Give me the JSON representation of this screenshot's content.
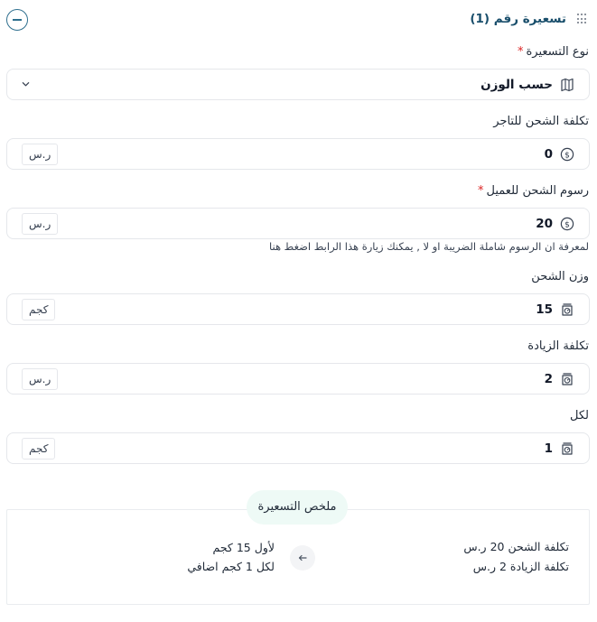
{
  "header": {
    "title": "تسعيرة رقم (1)"
  },
  "pricing_type": {
    "label": "نوع التسعيرة",
    "required_mark": "*",
    "value": "حسب الوزن"
  },
  "merchant_cost": {
    "label": "تكلفة الشحن للتاجر",
    "value": "0",
    "unit": "ر.س"
  },
  "customer_fee": {
    "label": "رسوم الشحن للعميل",
    "required_mark": "*",
    "value": "20",
    "unit": "ر.س",
    "hint": "لمعرفة ان الرسوم شاملة الضريبة او لا , يمكنك زيارة هذا الرابط اضغط هنا"
  },
  "weight": {
    "label": "وزن الشحن",
    "value": "15",
    "unit": "كجم"
  },
  "extra_cost": {
    "label": "تكلفة الزيادة",
    "value": "2",
    "unit": "ر.س"
  },
  "per": {
    "label": "لكل",
    "value": "1",
    "unit": "كجم"
  },
  "summary": {
    "title": "ملخص التسعيرة",
    "right_line1": "تكلفة الشحن 20 ر.س",
    "right_line2": "تكلفة الزيادة 2 ر.س",
    "left_line1": "لأول 15 كجم",
    "left_line2": "لكل 1 كجم اضافي"
  },
  "icons": {
    "collapse": "minus-circle-icon",
    "drag": "drag-handle-icon",
    "pricing_type": "map-weight-icon",
    "currency": "coin-icon",
    "weight": "scale-icon",
    "chevron": "chevron-down-icon",
    "arrow": "arrow-left-icon"
  },
  "colors": {
    "accent": "#1a4f6c",
    "required": "#dc2626",
    "summary_tag_bg": "#eefaf6"
  }
}
